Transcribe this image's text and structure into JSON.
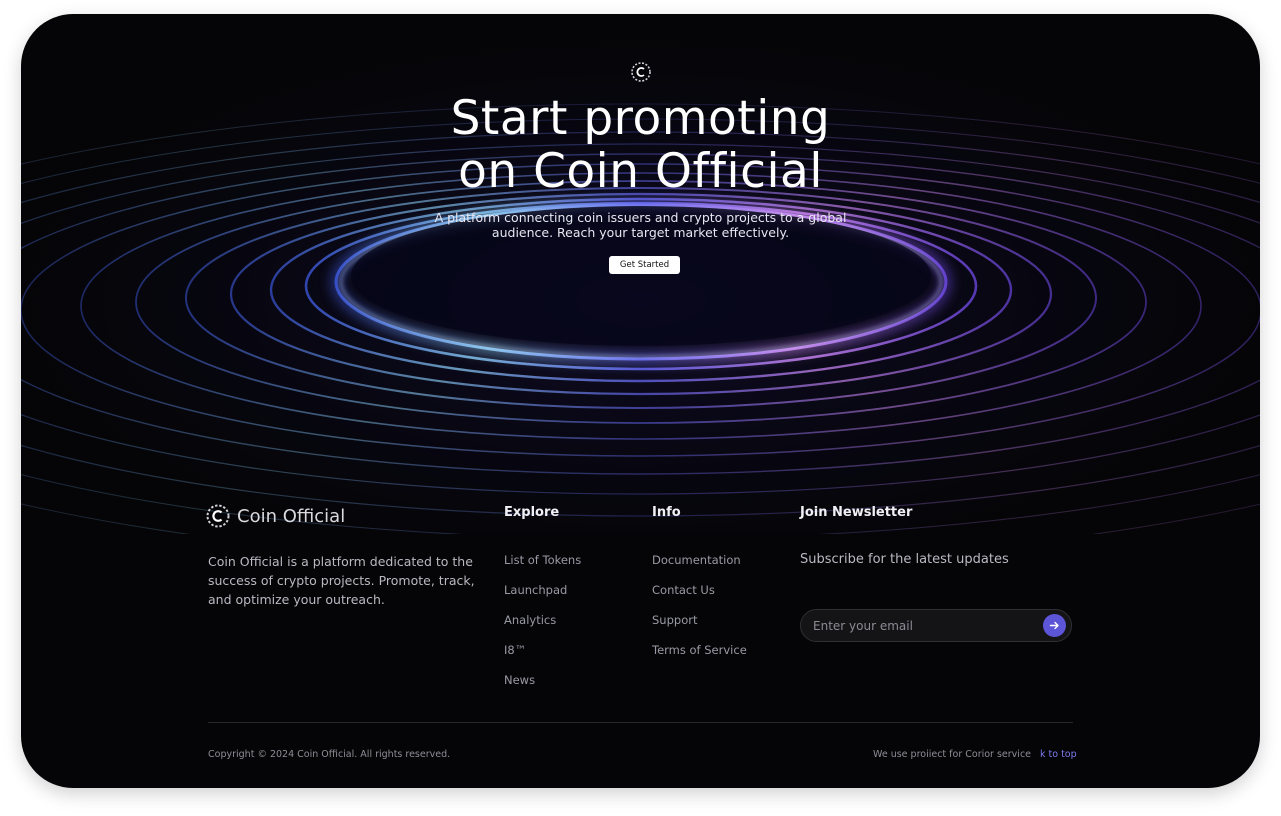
{
  "hero": {
    "title_line1": "Start promoting",
    "title_line2": "on Coin Official",
    "subtitle_line1": "A platform connecting coin issuers and crypto projects to a global",
    "subtitle_line2": "audience. Reach your target market effectively.",
    "cta_label": "Get Started",
    "icon": "coin-logo-icon"
  },
  "footer": {
    "brand": {
      "name": "Coin Official",
      "icon": "coin-logo-icon",
      "description": "Coin Official is a platform dedicated to the success of crypto projects. Promote, track, and optimize your outreach."
    },
    "explore": {
      "heading": "Explore",
      "items": [
        "List of Tokens",
        "Launchpad",
        "Analytics",
        "I8™",
        "News"
      ]
    },
    "info": {
      "heading": "Info",
      "items": [
        "Documentation",
        "Contact Us",
        "Support",
        "Terms of Service"
      ]
    },
    "newsletter": {
      "heading": "Join Newsletter",
      "subtitle": "Subscribe for the latest updates",
      "email_placeholder": "Enter your email",
      "submit_icon": "arrow-right-icon"
    },
    "bottom": {
      "copyright": "Copyright © 2024 Coin Official. All rights reserved.",
      "cookie_note": "We use proiiect for Corior service",
      "back_to_top": "k to top"
    }
  },
  "colors": {
    "background": "#050507",
    "accent": "#5d55d8",
    "link_accent": "#7d7bf0",
    "swirl_blue": "#6aa8ff",
    "swirl_purple": "#a35cff"
  }
}
